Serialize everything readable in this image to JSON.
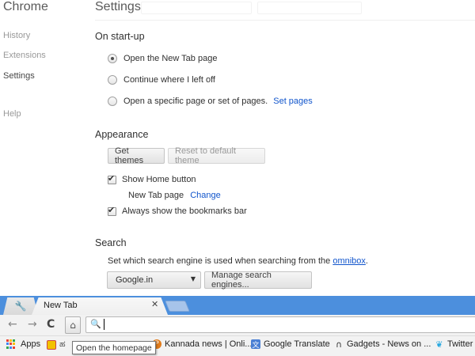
{
  "nav": {
    "title": "Chrome",
    "items": [
      {
        "label": "History"
      },
      {
        "label": "Extensions"
      },
      {
        "label": "Settings"
      },
      {
        "label": "Help"
      }
    ]
  },
  "settings": {
    "title": "Settings"
  },
  "startup": {
    "title": "On start-up",
    "options": [
      {
        "label": "Open the New Tab page",
        "checked": true
      },
      {
        "label": "Continue where I left off",
        "checked": false
      },
      {
        "label": "Open a specific page or set of pages.",
        "checked": false
      }
    ],
    "set_pages_link": "Set pages"
  },
  "appearance": {
    "title": "Appearance",
    "get_themes": "Get themes",
    "reset_theme": "Reset to default theme",
    "show_home_button": "Show Home button",
    "home_page_text": "New Tab page",
    "home_page_change": "Change",
    "show_bookmarks_bar": "Always show the bookmarks bar"
  },
  "search": {
    "title": "Search",
    "description": "Set which search engine is used when searching from the ",
    "omnibox_link": "omnibox",
    "description_end": ".",
    "engine_selected": "Google.in",
    "manage_button": "Manage search engines..."
  },
  "browser": {
    "tab_label": "New Tab",
    "tab_close_icon": "close-icon",
    "tooltip": "Open the homepage",
    "bookmarks": [
      {
        "label": "Apps",
        "icon": "apps-icon"
      },
      {
        "label": "ಹ",
        "icon": "bookmark-icon"
      },
      {
        "label": "Kannada news | Onli...",
        "icon": "bookmark-icon",
        "color": "#e07b1a"
      },
      {
        "label": "Google Translate",
        "icon": "translate-icon"
      },
      {
        "label": "Gadgets - News on ...",
        "icon": "headphones-icon"
      },
      {
        "label": "Twitter",
        "icon": "twitter-icon",
        "color": "#2aa9e0"
      }
    ]
  },
  "colors": {
    "link": "#1155cc",
    "tabstrip": "#4c8fdd"
  }
}
